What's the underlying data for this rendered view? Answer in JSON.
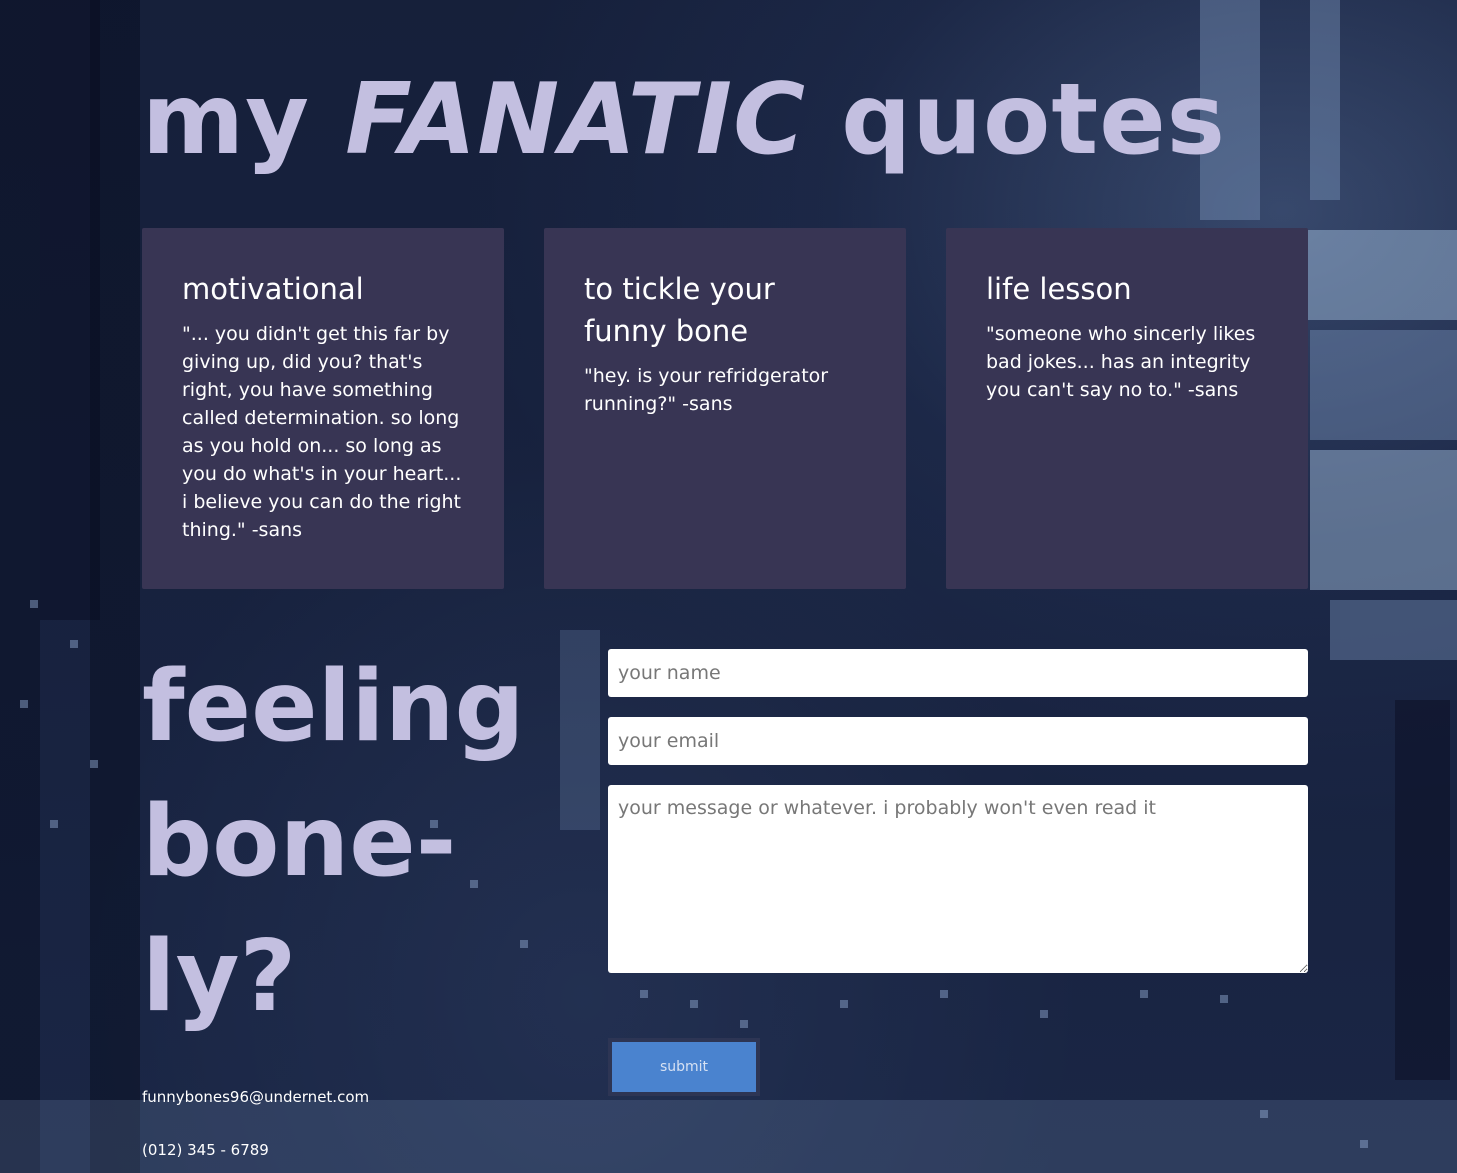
{
  "header": {
    "title_pre": "my",
    "title_emphasis": "FANATIC",
    "title_post": "quotes"
  },
  "cards": [
    {
      "title": "motivational",
      "quote": "\"... you didn't get this far by giving up, did you? that's right, you have something called determination. so long as you hold on... so long as you do what's in your heart... i believe you can do the right thing.\" -sans"
    },
    {
      "title": "to tickle your funny bone",
      "quote": "\"hey. is your refridgerator running?\" -sans"
    },
    {
      "title": "life lesson",
      "quote": "\"someone who sincerly likes bad jokes... has an integrity you can't say no to.\" -sans"
    }
  ],
  "contact_section": {
    "heading": "feeling bone-ly?",
    "email": "funnybones96@undernet.com",
    "phone": "(012) 345 - 6789"
  },
  "form": {
    "name_placeholder": "your name",
    "email_placeholder": "your email",
    "message_placeholder": "your message or whatever. i probably won't even read it",
    "submit_label": "submit"
  },
  "colors": {
    "title": "#c3bfe0",
    "card_background": "#383554",
    "submit_background": "#4a83cf",
    "page_background": "#16203a"
  }
}
